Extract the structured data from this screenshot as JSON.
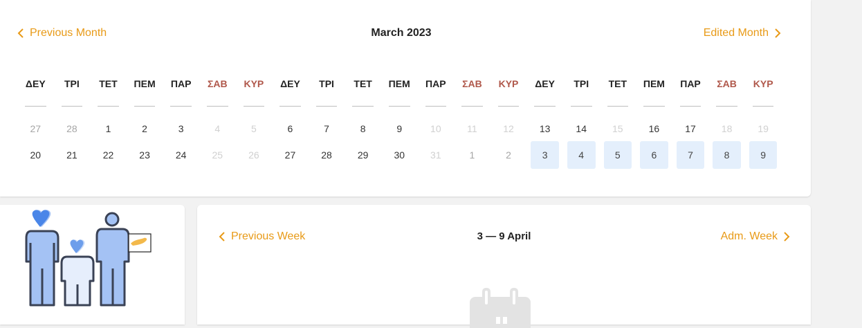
{
  "month": {
    "prev_label": "Previous Month",
    "title": "March 2023",
    "next_label": "Edited Month",
    "day_headers": [
      "ΔΕΥ",
      "ΤΡΙ",
      "ΤΕΤ",
      "ΠΕΜ",
      "ΠΑΡ",
      "ΣΑΒ",
      "ΚΥΡ",
      "ΔΕΥ",
      "ΤΡΙ",
      "ΤΕΤ",
      "ΠΕΜ",
      "ΠΑΡ",
      "ΣΑΒ",
      "ΚΥΡ",
      "ΔΕΥ",
      "ΤΡΙ",
      "ΤΕΤ",
      "ΠΕΜ",
      "ΠΑΡ",
      "ΣΑΒ",
      "ΚΥΡ"
    ],
    "row1": [
      "27",
      "28",
      "1",
      "2",
      "3",
      "4",
      "5",
      "6",
      "7",
      "8",
      "9",
      "10",
      "11",
      "12",
      "13",
      "14",
      "15",
      "16",
      "17",
      "18",
      "19"
    ],
    "row2": [
      "20",
      "21",
      "22",
      "23",
      "24",
      "25",
      "26",
      "27",
      "28",
      "29",
      "30",
      "31",
      "1",
      "2",
      "3",
      "4",
      "5",
      "6",
      "7",
      "8",
      "9"
    ]
  },
  "week": {
    "prev_label": "Previous Week",
    "title": "3 — 9 April",
    "next_label": "Adm. Week"
  },
  "colors": {
    "accent": "#e89a17",
    "weekend": "#b0584b",
    "selected_bg": "#e4effc"
  }
}
